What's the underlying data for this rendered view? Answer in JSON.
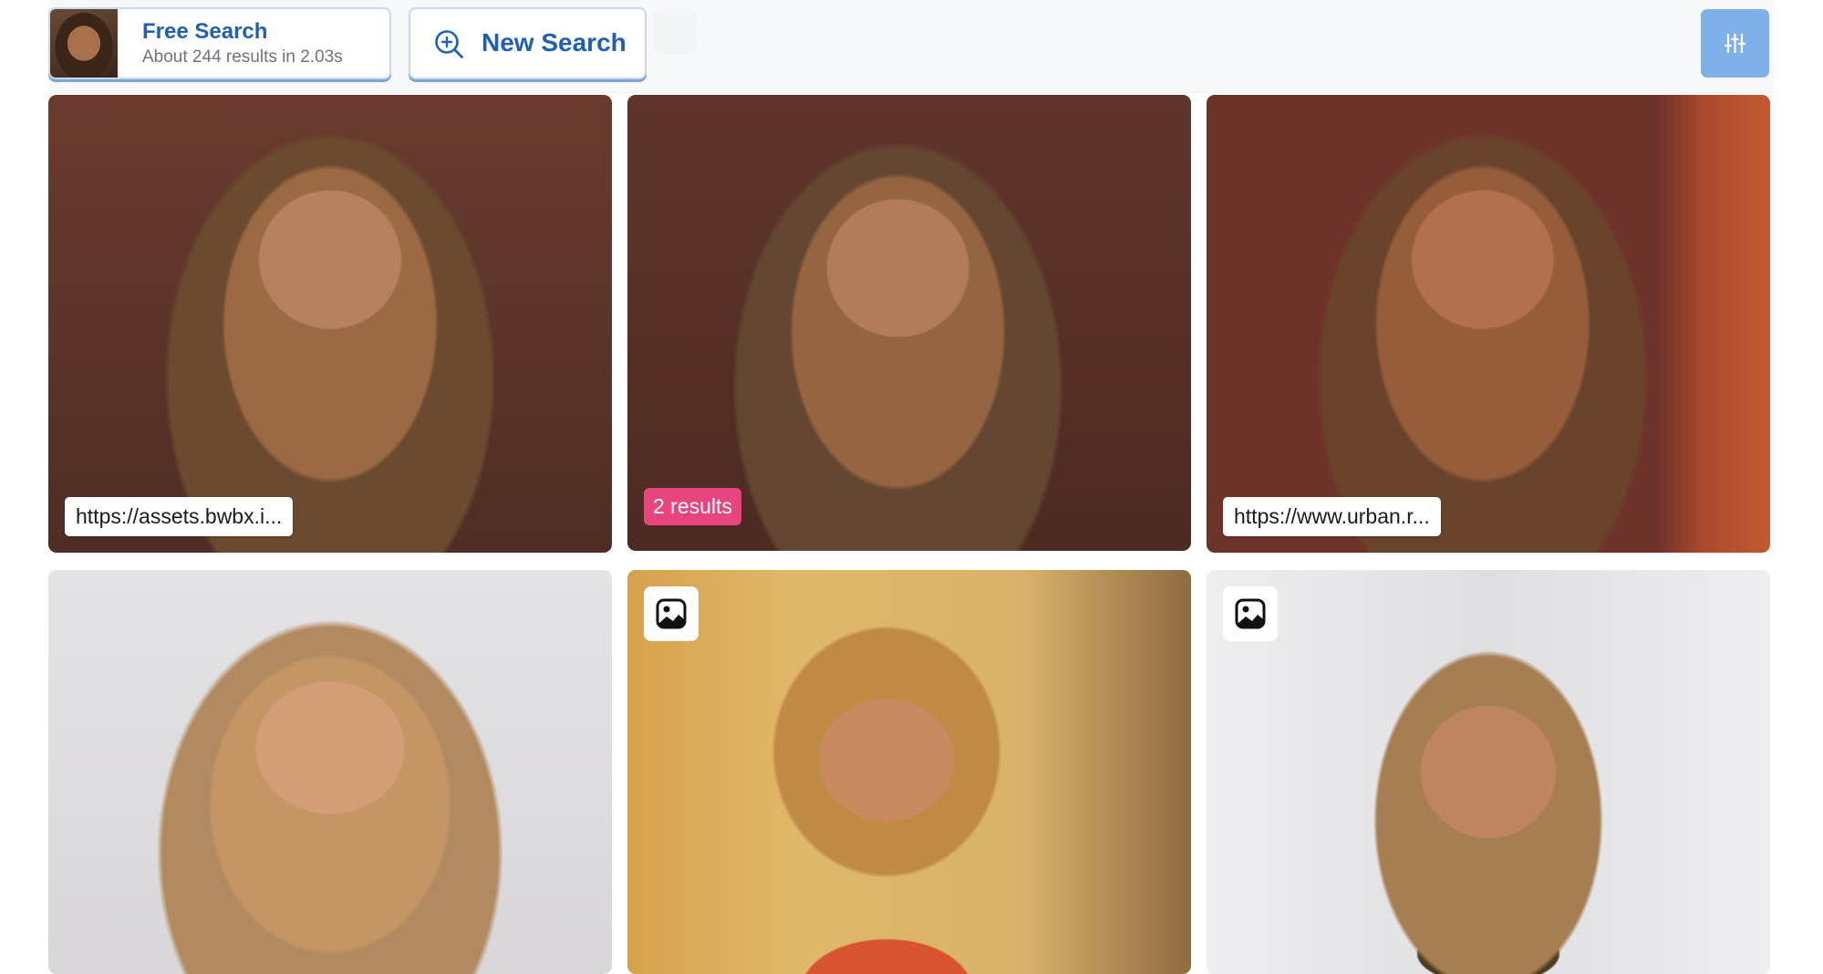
{
  "header": {
    "search_card": {
      "title": "Free Search",
      "subtitle": "About 244 results in 2.03s"
    },
    "new_search_button_label": "New Search",
    "filter_icon": "sliders-icon"
  },
  "results": [
    {
      "type": "source",
      "source_label": "https://assets.bwbx.i..."
    },
    {
      "type": "count",
      "results_label": "2 results"
    },
    {
      "type": "source",
      "source_label": "https://www.urban.r..."
    },
    {
      "type": "plain"
    },
    {
      "type": "image-icon",
      "icon": "image-icon"
    },
    {
      "type": "image-icon",
      "icon": "image-icon"
    }
  ],
  "colors": {
    "accent": "#1f5fb4",
    "filter_button": "#80b0ea",
    "results_badge": "#e8457f"
  }
}
